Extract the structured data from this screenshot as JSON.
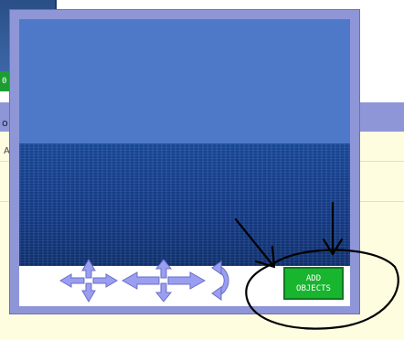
{
  "background": {
    "green_tab_text": "0",
    "row_text": "o",
    "row_text_small": "A"
  },
  "dialog": {
    "add_objects_line1": "ADD",
    "add_objects_line2": "OBJECTS"
  },
  "colors": {
    "dialog_frame": "#8f96d8",
    "sky": "#4e79c8",
    "sea": "#173f8f",
    "button_green": "#18b52f",
    "panel_yellow": "#fffde0"
  },
  "icons": [
    "pan-arrows-icon",
    "move-arrows-icon",
    "rotate-icon",
    "hand-drawn-arrow-icon",
    "hand-drawn-circle-icon"
  ]
}
